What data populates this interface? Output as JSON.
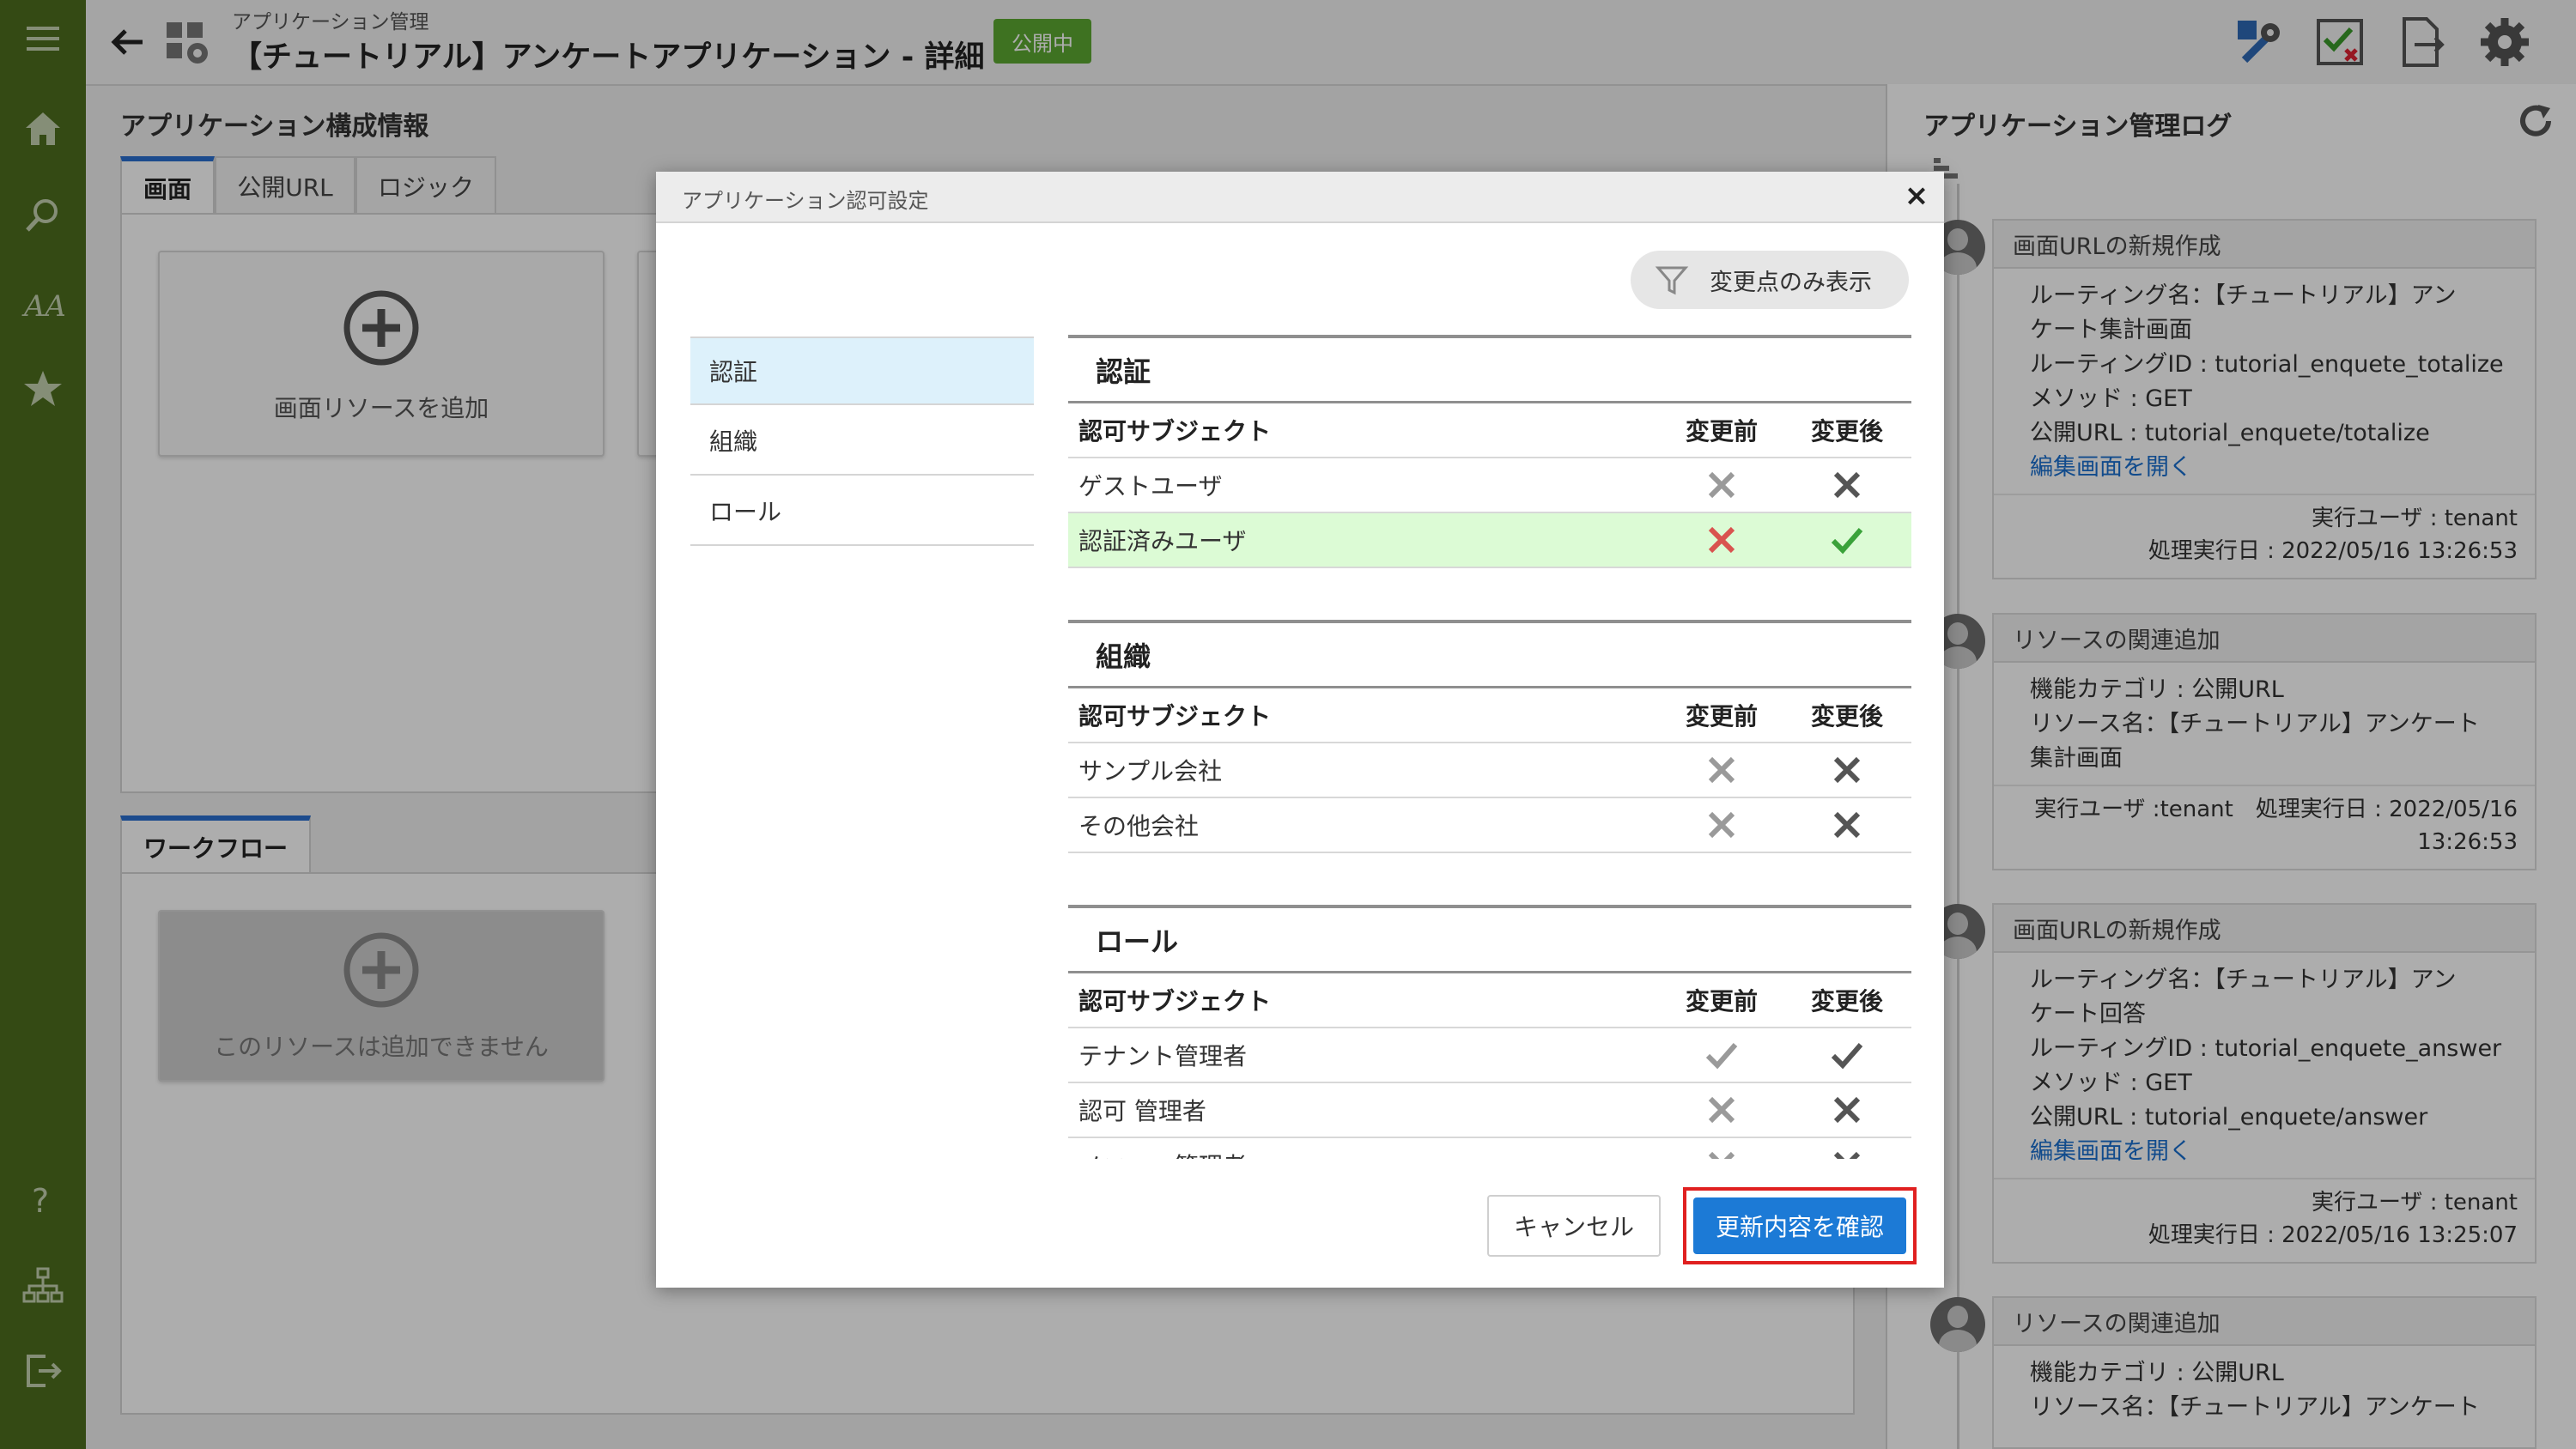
{
  "header": {
    "breadcrumb": "アプリケーション管理",
    "title": "【チュートリアル】アンケートアプリケーション - 詳細",
    "status_badge": "公開中"
  },
  "config_panel": {
    "title": "アプリケーション構成情報",
    "tabs": [
      "画面",
      "公開URL",
      "ロジック"
    ],
    "add_screen_label": "画面リソースを追加"
  },
  "workflow_panel": {
    "tab": "ワークフロー",
    "disabled_label": "このリソースは追加できません"
  },
  "log_panel": {
    "title": "アプリケーション管理ログ",
    "entries": [
      {
        "title": "画面URLの新規作成",
        "lines": [
          "ルーティング名：【チュートリアル】アン",
          "ケート集計画面",
          "ルーティングID : tutorial_enquete_totalize",
          "メソッド : GET",
          "公開URL : tutorial_enquete/totalize"
        ],
        "link": "編集画面を開く",
        "footer": [
          "実行ユーザ : tenant",
          "処理実行日 : 2022/05/16 13:26:53"
        ]
      },
      {
        "title": "リソースの関連追加",
        "lines": [
          "機能カテゴリ : 公開URL",
          "リソース名：【チュートリアル】アンケート",
          "集計画面"
        ],
        "footer": [
          "実行ユーザ :tenant　処理実行日 : 2022/05/16",
          "13:26:53"
        ]
      },
      {
        "title": "画面URLの新規作成",
        "lines": [
          "ルーティング名：【チュートリアル】アン",
          "ケート回答",
          "ルーティングID : tutorial_enquete_answer",
          "メソッド : GET",
          "公開URL : tutorial_enquete/answer"
        ],
        "link": "編集画面を開く",
        "footer": [
          "実行ユーザ : tenant",
          "処理実行日 : 2022/05/16 13:25:07"
        ]
      },
      {
        "title": "リソースの関連追加",
        "lines": [
          "機能カテゴリ : 公開URL",
          "リソース名：【チュートリアル】アンケート"
        ]
      }
    ]
  },
  "dialog": {
    "title": "アプリケーション認可設定",
    "filter_label": "変更点のみ表示",
    "nav": [
      "認証",
      "組織",
      "ロール"
    ],
    "col_subject": "認可サブジェクト",
    "col_before": "変更前",
    "col_after": "変更後",
    "sections": [
      {
        "title": "認証",
        "rows": [
          {
            "subject": "ゲストユーザ",
            "before": "deny",
            "after": "deny",
            "changed": false
          },
          {
            "subject": "認証済みユーザ",
            "before": "deny",
            "after": "allow",
            "changed": true
          }
        ]
      },
      {
        "title": "組織",
        "rows": [
          {
            "subject": "サンプル会社",
            "before": "deny",
            "after": "deny",
            "changed": false
          },
          {
            "subject": "その他会社",
            "before": "deny",
            "after": "deny",
            "changed": false
          }
        ]
      },
      {
        "title": "ロール",
        "rows": [
          {
            "subject": "テナント管理者",
            "before": "allow",
            "after": "allow",
            "changed": false
          },
          {
            "subject": "認可 管理者",
            "before": "deny",
            "after": "deny",
            "changed": false
          },
          {
            "subject": "メニュー管理者",
            "before": "deny",
            "after": "deny",
            "changed": false
          }
        ]
      }
    ],
    "cancel_label": "キャンセル",
    "confirm_label": "更新内容を確認"
  }
}
